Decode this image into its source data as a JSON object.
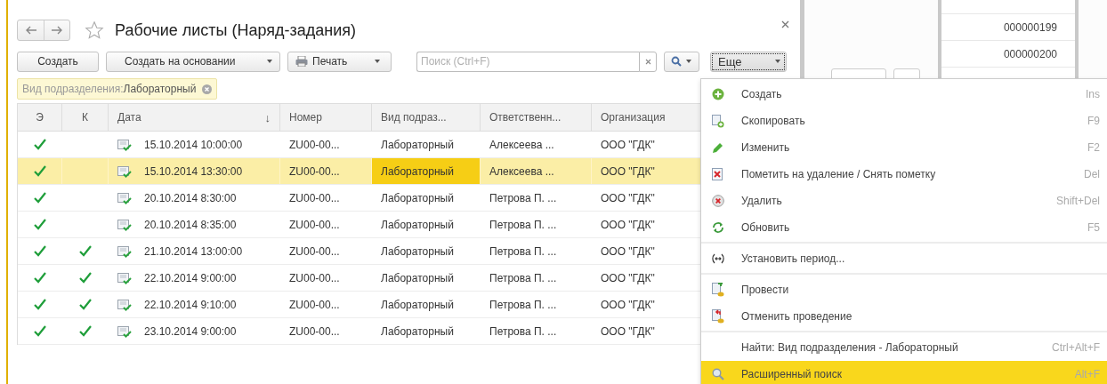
{
  "window": {
    "title": "Рабочие листы (Наряд-задания)",
    "favorite": false
  },
  "toolbar": {
    "buttons": [
      {
        "label": "Создать",
        "kind": "plain"
      },
      {
        "label": "Создать на основании",
        "kind": "dropdown"
      },
      {
        "label": "Печать",
        "kind": "print"
      }
    ],
    "search": {
      "placeholder": "Поиск (Ctrl+F)"
    },
    "more": {
      "label": "Еще",
      "expanded": true
    }
  },
  "filter": {
    "label": "Вид подразделения:",
    "value": "Лабораторный"
  },
  "table": {
    "columns": [
      "Э",
      "К",
      "Дата",
      "Номер",
      "Вид подраз...",
      "Ответственн...",
      "Организация"
    ],
    "sort_icon": "↓",
    "rows": [
      {
        "e": true,
        "k": false,
        "date": "15.10.2014 10:00:00",
        "number": "ZU00-00...",
        "vid": "Лабораторный",
        "resp": "Алексеева ...",
        "org": "ООО \"ГДК\"",
        "selected": false
      },
      {
        "e": true,
        "k": false,
        "date": "15.10.2014 13:30:00",
        "number": "ZU00-00...",
        "vid": "Лабораторный",
        "resp": "Алексеева ...",
        "org": "ООО \"ГДК\"",
        "selected": true
      },
      {
        "e": true,
        "k": false,
        "date": "20.10.2014 8:30:00",
        "number": "ZU00-00...",
        "vid": "Лабораторный",
        "resp": "Петрова П. ...",
        "org": "ООО \"ГДК\"",
        "selected": false
      },
      {
        "e": true,
        "k": false,
        "date": "20.10.2014 8:35:00",
        "number": "ZU00-00...",
        "vid": "Лабораторный",
        "resp": "Петрова П. ...",
        "org": "ООО \"ГДК\"",
        "selected": false
      },
      {
        "e": true,
        "k": true,
        "date": "21.10.2014 13:00:00",
        "number": "ZU00-00...",
        "vid": "Лабораторный",
        "resp": "Петрова П. ...",
        "org": "ООО \"ГДК\"",
        "selected": false
      },
      {
        "e": true,
        "k": true,
        "date": "22.10.2014 9:00:00",
        "number": "ZU00-00...",
        "vid": "Лабораторный",
        "resp": "Петрова П. ...",
        "org": "ООО \"ГДК\"",
        "selected": false
      },
      {
        "e": true,
        "k": true,
        "date": "22.10.2014 9:10:00",
        "number": "ZU00-00...",
        "vid": "Лабораторный",
        "resp": "Петрова П. ...",
        "org": "ООО \"ГДК\"",
        "selected": false
      },
      {
        "e": true,
        "k": true,
        "date": "23.10.2014 9:00:00",
        "number": "ZU00-00...",
        "vid": "Лабораторный",
        "resp": "Петрова П. ...",
        "org": "ООО \"ГДК\"",
        "selected": false
      }
    ]
  },
  "background_window": {
    "numbers": [
      "000000199",
      "000000200"
    ]
  },
  "menu": {
    "items": [
      {
        "kind": "add",
        "label": "Создать",
        "shortcut": "Ins",
        "separator_before": false,
        "selected": false
      },
      {
        "kind": "copy",
        "label": "Скопировать",
        "shortcut": "F9",
        "separator_before": false,
        "selected": false
      },
      {
        "kind": "edit",
        "label": "Изменить",
        "shortcut": "F2",
        "separator_before": false,
        "selected": false
      },
      {
        "kind": "mark",
        "label": "Пометить на удаление / Снять пометку",
        "shortcut": "Del",
        "separator_before": false,
        "selected": false
      },
      {
        "kind": "delete",
        "label": "Удалить",
        "shortcut": "Shift+Del",
        "separator_before": false,
        "selected": false
      },
      {
        "kind": "refresh",
        "label": "Обновить",
        "shortcut": "F5",
        "separator_before": false,
        "selected": false
      },
      {
        "kind": "period",
        "label": "Установить период...",
        "separator_before": true,
        "selected": false
      },
      {
        "kind": "post",
        "label": "Провести",
        "separator_before": true,
        "selected": false
      },
      {
        "kind": "unpost",
        "label": "Отменить проведение",
        "separator_before": false,
        "selected": false
      },
      {
        "kind": "none",
        "label": "Найти: Вид подразделения - Лабораторный",
        "shortcut": "Ctrl+Alt+F",
        "separator_before": true,
        "selected": false
      },
      {
        "kind": "search",
        "label": "Расширенный поиск",
        "shortcut": "Alt+F",
        "separator_before": false,
        "selected": true
      }
    ]
  }
}
